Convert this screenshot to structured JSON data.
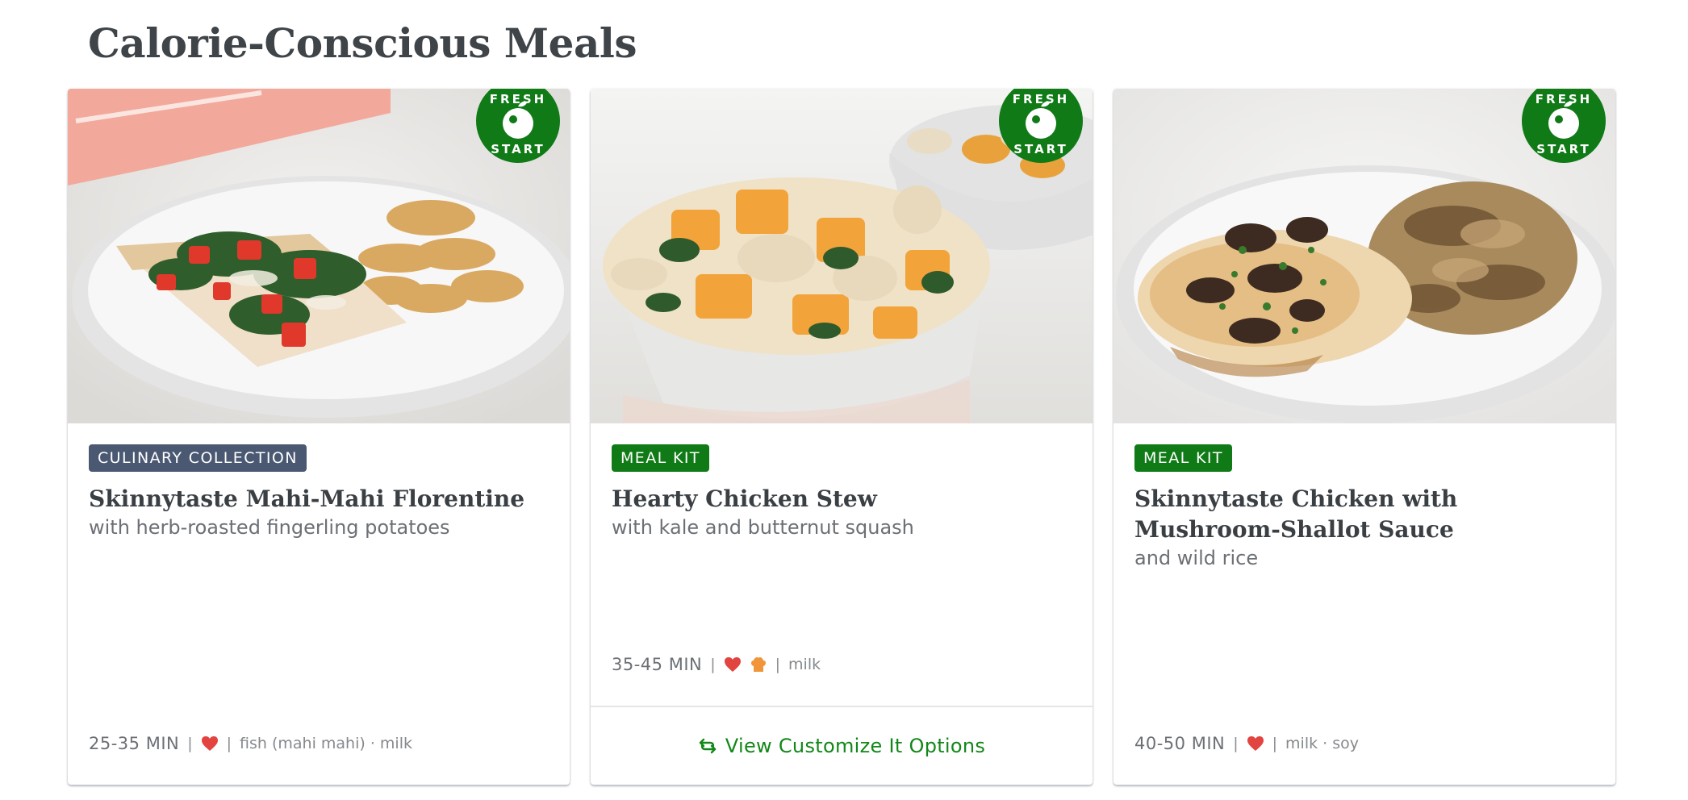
{
  "page": {
    "title": "Calorie-Conscious Meals"
  },
  "badge": {
    "top": "FRESH",
    "bottom": "START",
    "color": "#0f7a16"
  },
  "colors": {
    "green_tag": "#0f7a16",
    "slate_tag": "#4a5872",
    "heart": "#e2443f",
    "chef": "#f0953a",
    "link": "#128718"
  },
  "cards": [
    {
      "tag": "CULINARY COLLECTION",
      "title": "Skinnytaste Mahi-Mahi Florentine",
      "subtitle": "with herb-roasted fingerling potatoes",
      "time": "25-35 MIN",
      "icons": [
        "heart-icon"
      ],
      "allergens": "fish (mahi mahi) · milk"
    },
    {
      "tag": "MEAL KIT",
      "title": "Hearty Chicken Stew",
      "subtitle": "with kale and butternut squash",
      "time": "35-45 MIN",
      "icons": [
        "heart-icon",
        "chef-hat-icon"
      ],
      "allergens": "milk",
      "customize_label": "View Customize It Options"
    },
    {
      "tag": "MEAL KIT",
      "title": "Skinnytaste Chicken with Mushroom-Shallot Sauce",
      "subtitle": "and wild rice",
      "time": "40-50 MIN",
      "icons": [
        "heart-icon"
      ],
      "allergens": "milk · soy"
    }
  ]
}
